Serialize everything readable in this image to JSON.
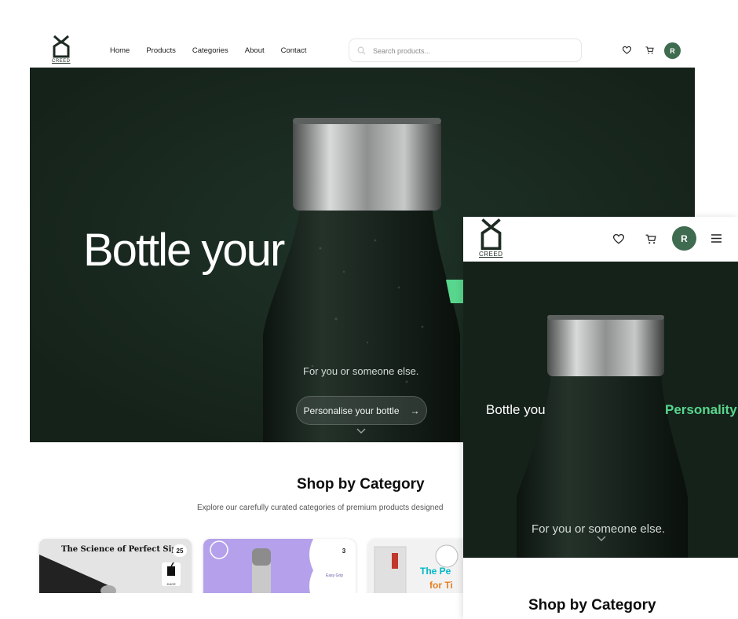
{
  "brand": {
    "logo_text": "CREED"
  },
  "desktop": {
    "nav": {
      "links": [
        "Home",
        "Products",
        "Categories",
        "About",
        "Contact"
      ],
      "search_placeholder": "Search products...",
      "avatar_initial": "R"
    },
    "hero": {
      "title": "Bottle your",
      "subtitle": "For you or someone else.",
      "cta_label": "Personalise your bottle",
      "cta_arrow": "→"
    },
    "shop": {
      "title": "Shop by Category",
      "description": "Explore our carefully curated categories of premium products designed",
      "cards": [
        {
          "title": "The Science of Perfect Sips",
          "count": "25",
          "tag": "JUICE"
        },
        {
          "title": "",
          "count": "3",
          "tag": "Easy Grip"
        },
        {
          "title": "The Pe",
          "title2": "for Ti",
          "count": ""
        }
      ]
    }
  },
  "mobile": {
    "avatar_initial": "R",
    "hero": {
      "title": "Bottle you",
      "accent": "Personality",
      "subtitle": "For you or someone else."
    },
    "shop": {
      "title": "Shop by Category"
    }
  },
  "colors": {
    "hero_bg": "#15221a",
    "accent_green": "#58d68d",
    "avatar": "#3f6b50"
  },
  "icons": [
    "creed-logo",
    "search-icon",
    "heart-icon",
    "cart-icon",
    "menu-icon",
    "arrow-right-icon",
    "chevron-down-icon"
  ]
}
